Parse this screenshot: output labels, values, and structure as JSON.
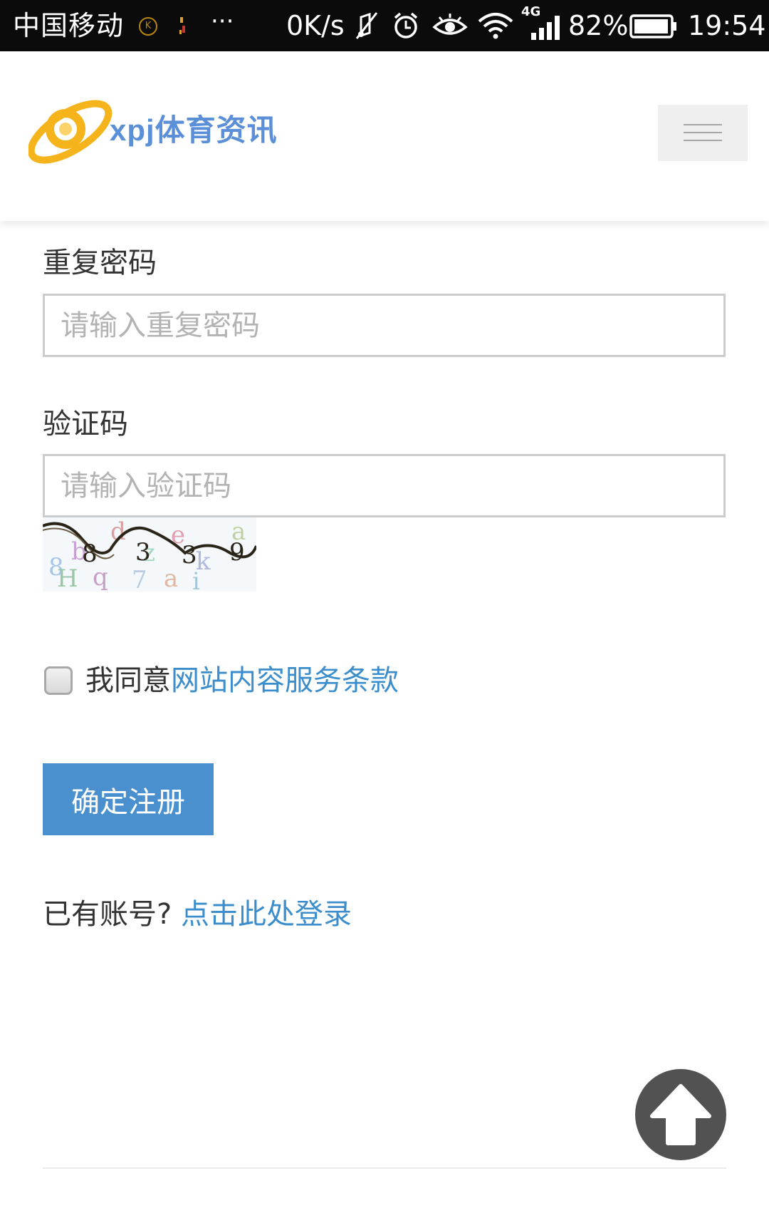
{
  "status_bar": {
    "carrier": "中国移动",
    "k_icon": "K",
    "overflow_dots": "···",
    "network_speed": "0K/s",
    "network_type": "4G",
    "battery_percent": "82%",
    "time": "19:54",
    "icons": [
      "mute-icon",
      "alarm-icon",
      "eye-icon",
      "wifi-icon",
      "signal-icon",
      "battery-icon"
    ]
  },
  "header": {
    "logo_text": "xpj体育资讯",
    "menu_icon": "hamburger-menu-icon"
  },
  "form": {
    "repeat_password": {
      "label": "重复密码",
      "placeholder": "请输入重复密码",
      "value": ""
    },
    "captcha": {
      "label": "验证码",
      "placeholder": "请输入验证码",
      "value": ""
    },
    "agree": {
      "checked": false,
      "text": "我同意",
      "link_text": "网站内容服务条款"
    },
    "submit_label": "确定注册",
    "login_prompt": "已有账号?",
    "login_link": "点击此处登录"
  },
  "back_to_top_icon": "arrow-up-icon",
  "colors": {
    "status_bar_bg": "#0b0b0b",
    "link": "#3c8dcc",
    "primary_button": "#4a90cf",
    "input_border": "#cccccc",
    "placeholder": "#b3b3b3",
    "back_to_top_bg": "#525252",
    "logo_blue": "#5b8fd8",
    "logo_orange": "#f5b31c"
  }
}
